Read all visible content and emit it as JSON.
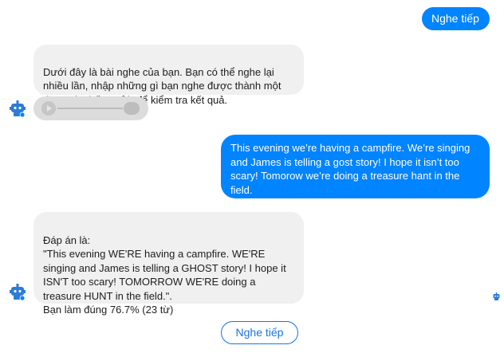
{
  "chat": {
    "messages": [
      {
        "sender": "user",
        "text": "Nghe tiếp"
      },
      {
        "sender": "bot",
        "text": "Dưới đây là bài nghe của bạn. Bạn có thể nghe lại nhiều lần, nhập những gì bạn nghe được thành một đoạn và nhấn \"Gửi\" để kiểm tra kết quả."
      },
      {
        "sender": "bot",
        "type": "audio",
        "progress": 0.0
      },
      {
        "sender": "user",
        "text": "This evening we’re having a campfire. We’re singing and James is telling a gost story! I hope it isn’t too scary! Tomorow we’re doing a treasure hant in the field."
      },
      {
        "sender": "bot",
        "text": "Đáp án là:\n\"This evening WE'RE having a campfire. WE'RE singing and James is telling a GHOST story! I hope it ISN'T too scary! TOMORROW WE'RE doing a treasure HUNT in the field.\".\nBạn làm đúng 76.7% (23 từ)"
      }
    ],
    "quick_reply": "Nghe tiếp"
  },
  "colors": {
    "user_bubble": "#0084ff",
    "bot_bubble": "#f1f0f0",
    "accent": "#1a73e8"
  },
  "icons": [
    "robot-icon",
    "messenger-badge-icon",
    "play-icon"
  ]
}
